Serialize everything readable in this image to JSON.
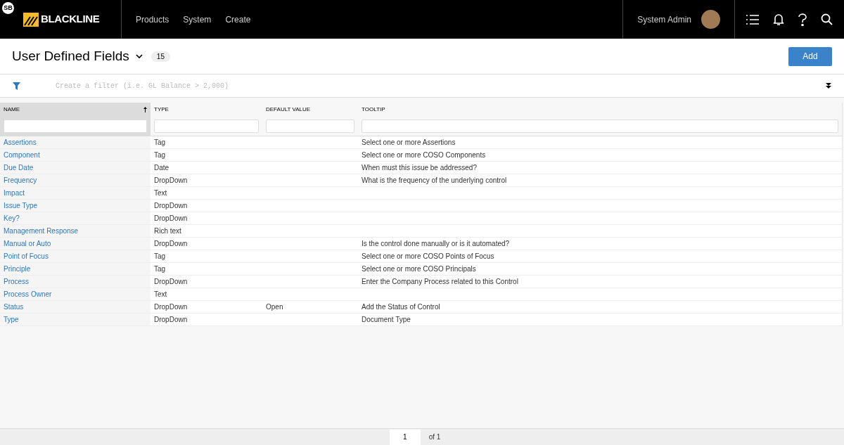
{
  "header": {
    "badge": "SB",
    "logo_text": "BLACKLINE",
    "nav": [
      "Products",
      "System",
      "Create"
    ],
    "user": "System Admin"
  },
  "page": {
    "title": "User Defined Fields",
    "count": "15",
    "add_button": "Add"
  },
  "filter": {
    "placeholder": "Create a filter (i.e. GL Balance > 2,000)"
  },
  "table": {
    "columns": [
      {
        "label": "NAME",
        "sorted": true
      },
      {
        "label": "TYPE",
        "sorted": false
      },
      {
        "label": "DEFAULT VALUE",
        "sorted": false
      },
      {
        "label": "TOOLTIP",
        "sorted": false
      }
    ],
    "rows": [
      {
        "name": "Assertions",
        "type": "Tag",
        "default": "",
        "tooltip": "Select one or more Assertions"
      },
      {
        "name": "Component",
        "type": "Tag",
        "default": "",
        "tooltip": "Select one or more COSO Components"
      },
      {
        "name": "Due Date",
        "type": "Date",
        "default": "",
        "tooltip": "When must this issue be addressed?"
      },
      {
        "name": "Frequency",
        "type": "DropDown",
        "default": "",
        "tooltip": "What is the frequency of the underlying control"
      },
      {
        "name": "Impact",
        "type": "Text",
        "default": "",
        "tooltip": ""
      },
      {
        "name": "Issue Type",
        "type": "DropDown",
        "default": "",
        "tooltip": ""
      },
      {
        "name": "Key?",
        "type": "DropDown",
        "default": "",
        "tooltip": ""
      },
      {
        "name": "Management Response",
        "type": "Rich text",
        "default": "",
        "tooltip": ""
      },
      {
        "name": "Manual or Auto",
        "type": "DropDown",
        "default": "",
        "tooltip": "Is the control done manually or is it automated?"
      },
      {
        "name": "Point of Focus",
        "type": "Tag",
        "default": "",
        "tooltip": "Select one or more COSO Points of Focus"
      },
      {
        "name": "Principle",
        "type": "Tag",
        "default": "",
        "tooltip": "Select one or more COSO Principals"
      },
      {
        "name": "Process",
        "type": "DropDown",
        "default": "",
        "tooltip": "Enter the Company Process related to this Control"
      },
      {
        "name": "Process Owner",
        "type": "Text",
        "default": "",
        "tooltip": ""
      },
      {
        "name": "Status",
        "type": "DropDown",
        "default": "Open",
        "tooltip": "Add the Status of Control"
      },
      {
        "name": "Type",
        "type": "DropDown",
        "default": "",
        "tooltip": "Document Type"
      }
    ]
  },
  "pagination": {
    "page": "1",
    "of_label": "of 1"
  }
}
